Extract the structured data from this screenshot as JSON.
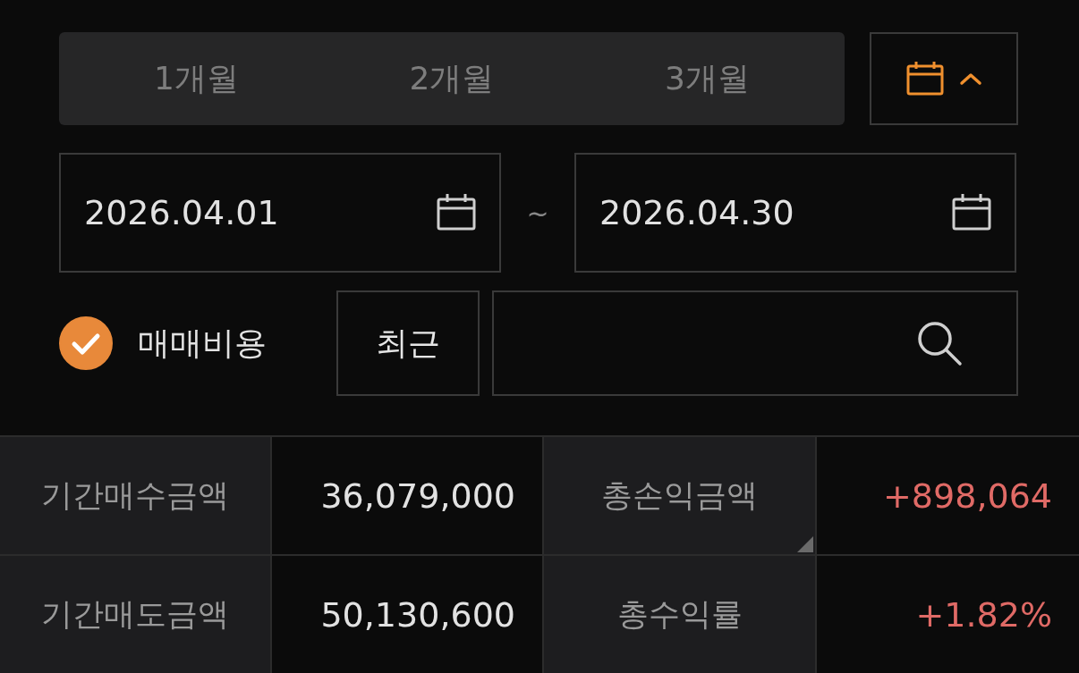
{
  "period_tabs": [
    {
      "label": "1개월",
      "selected": false
    },
    {
      "label": "2개월",
      "selected": false
    },
    {
      "label": "3개월",
      "selected": false
    }
  ],
  "calendar_toggle": {
    "expanded": true
  },
  "date_range": {
    "start": "2026.04.01",
    "separator": "~",
    "end": "2026.04.30"
  },
  "fee_option": {
    "label": "매매비용",
    "checked": true
  },
  "recent_button": "최근",
  "summary": [
    {
      "label": "기간매수금액",
      "value": "36,079,000",
      "color": "#e2e2e2",
      "corner_mark": false
    },
    {
      "label": "총손익금액",
      "value": "+898,064",
      "color": "#e06a66",
      "corner_mark": true
    },
    {
      "label": "기간매도금액",
      "value": "50,130,600",
      "color": "#e2e2e2",
      "corner_mark": false
    },
    {
      "label": "총수익률",
      "value": "+1.82%",
      "color": "#e06a66",
      "corner_mark": false
    }
  ]
}
